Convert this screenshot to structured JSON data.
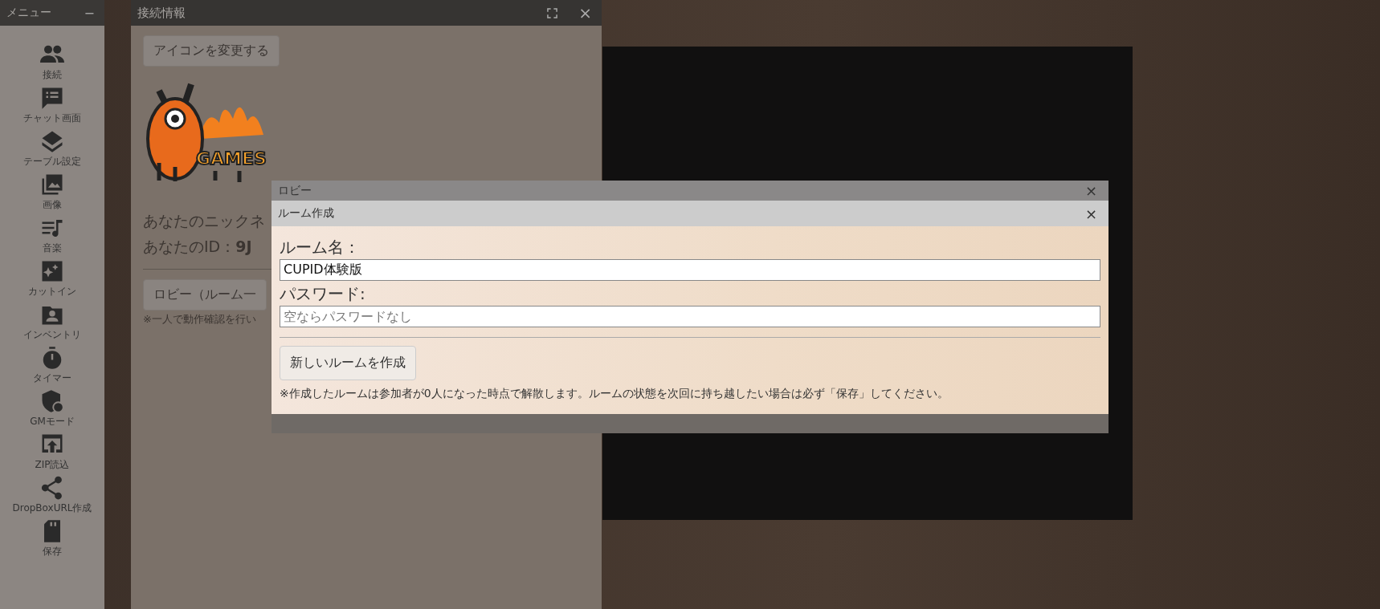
{
  "menu": {
    "title": "メニュー",
    "minimize": "−",
    "items": [
      {
        "kind": "people",
        "label": "接続"
      },
      {
        "kind": "chat",
        "label": "チャット画面"
      },
      {
        "kind": "layers",
        "label": "テーブル設定"
      },
      {
        "kind": "image",
        "label": "画像"
      },
      {
        "kind": "music",
        "label": "音楽"
      },
      {
        "kind": "clapper",
        "label": "カットイン"
      },
      {
        "kind": "folder",
        "label": "インベントリ"
      },
      {
        "kind": "timer",
        "label": "タイマー"
      },
      {
        "kind": "shield",
        "label": "GMモード"
      },
      {
        "kind": "upload",
        "label": "ZIP読込"
      },
      {
        "kind": "share",
        "label": "DropBoxURL作成"
      },
      {
        "kind": "card",
        "label": "保存"
      }
    ]
  },
  "connection_window": {
    "title": "接続情報",
    "close": "×",
    "change_icon_button": "アイコンを変更する",
    "logo_text": "GAMES",
    "nickname_line": "あなたのニックネ",
    "id_line": "あなたのID：**9J**",
    "lobby_button": "ロビー（ルーム一",
    "note": "※一人で動作確認を行い"
  },
  "lobby_dialog": {
    "title": "ロビー",
    "close": "×",
    "create_room": {
      "title": "ルーム作成",
      "close": "×",
      "room_name_label": "ルーム名：",
      "room_name_value": "CUPID体験版",
      "password_label": "パスワード:",
      "password_placeholder": "空ならパスワードなし",
      "create_button": "新しいルームを作成",
      "note": "※作成したルームは参加者が0人になった時点で解散します。ルームの状態を次回に持ち越したい場合は必ず「保存」してください。"
    }
  }
}
